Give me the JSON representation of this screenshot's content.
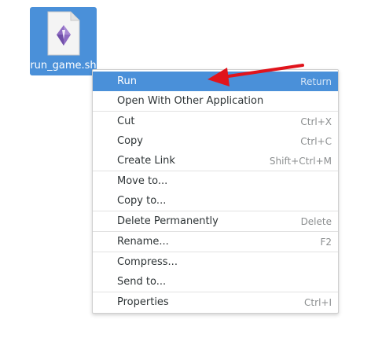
{
  "desktop": {
    "file": {
      "name": "run_game.sh",
      "icon": "shell-script-icon"
    }
  },
  "context_menu": {
    "items": [
      {
        "label": "Run",
        "accel": "Return",
        "active": true
      },
      {
        "label": "Open With Other Application",
        "accel": ""
      },
      {
        "label": "Cut",
        "accel": "Ctrl+X"
      },
      {
        "label": "Copy",
        "accel": "Ctrl+C"
      },
      {
        "label": "Create Link",
        "accel": "Shift+Ctrl+M"
      },
      {
        "label": "Move to...",
        "accel": ""
      },
      {
        "label": "Copy to...",
        "accel": ""
      },
      {
        "label": "Delete Permanently",
        "accel": "Delete"
      },
      {
        "label": "Rename...",
        "accel": "F2"
      },
      {
        "label": "Compress...",
        "accel": ""
      },
      {
        "label": "Send to...",
        "accel": ""
      },
      {
        "label": "Properties",
        "accel": "Ctrl+I"
      }
    ]
  },
  "colors": {
    "selection": "#4a90d9",
    "annotation_arrow": "#e0141c"
  }
}
